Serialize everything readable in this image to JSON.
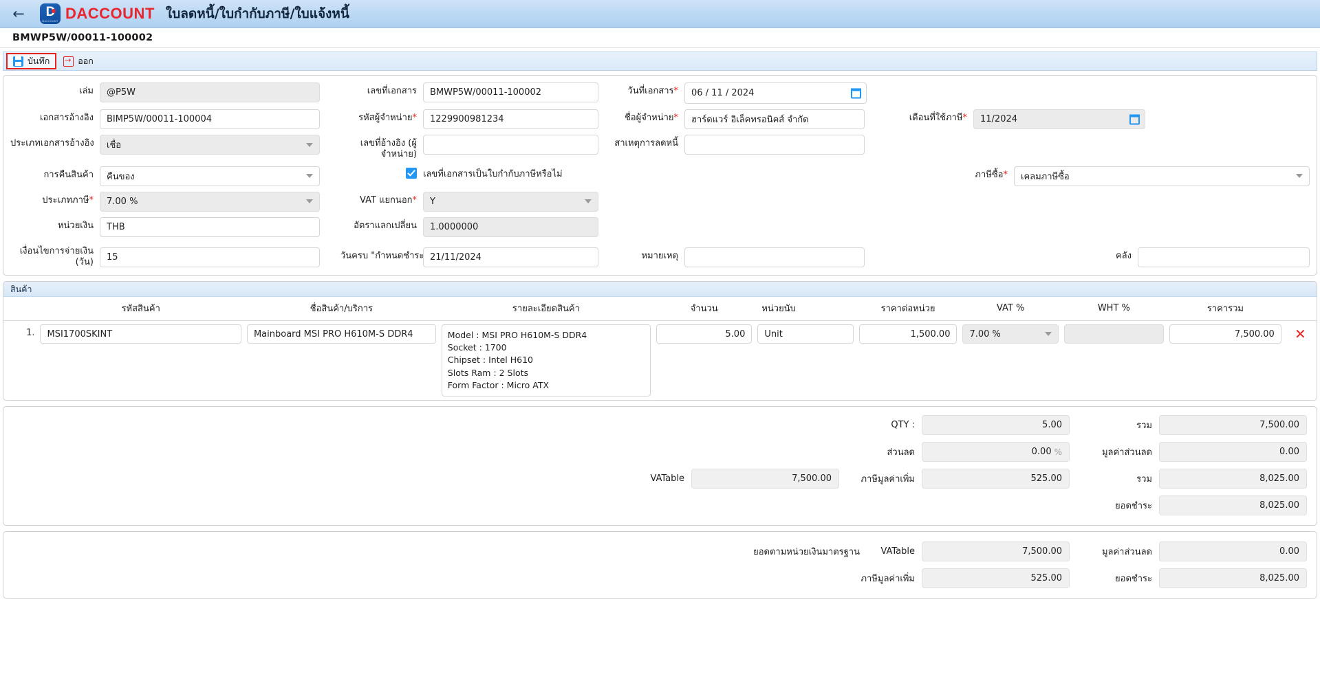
{
  "header": {
    "back_icon": "back-arrow-icon",
    "brand": "DACCOUNT",
    "brand_letter": "D",
    "logo_subtext": "DACCOUNT",
    "page_title": "ใบลดหนี้/ใบกำกับภาษี/ใบแจ้งหนี้",
    "document_number": "BMWP5W/00011-100002"
  },
  "toolbar": {
    "save_label": "บันทึก",
    "exit_label": "ออก",
    "save_icon": "save-disk-icon",
    "exit_icon": "exit-arrow-icon"
  },
  "form": {
    "book": {
      "label": "เล่ม",
      "value": "@P5W"
    },
    "doc_no": {
      "label": "เลขที่เอกสาร",
      "value": "BMWP5W/00011-100002"
    },
    "doc_date": {
      "label": "วันที่เอกสาร",
      "required": "*",
      "value": "06 / 11 / 2024"
    },
    "ref_doc": {
      "label": "เอกสารอ้างอิง",
      "value": "BIMP5W/00011-100004"
    },
    "vendor_code": {
      "label": "รหัสผู้จำหน่าย",
      "required": "*",
      "value": "1229900981234"
    },
    "vendor_name": {
      "label": "ชื่อผู้จำหน่าย",
      "required": "*",
      "value": "ฮาร์ดแวร์ อิเล็คทรอนิคส์ จำกัด"
    },
    "tax_month": {
      "label": "เดือนที่ใช้ภาษี",
      "required": "*",
      "value": "11/2024"
    },
    "ref_doc_type": {
      "label": "ประเภทเอกสารอ้างอิง",
      "value": "เชื่อ"
    },
    "vendor_ref_no": {
      "label": "เลขที่อ้างอิง (ผู้จำหน่าย)",
      "value": ""
    },
    "credit_reason": {
      "label": "สาเหตุการลดหนี้",
      "value": ""
    },
    "return_goods": {
      "label": "การคืนสินค้า",
      "value": "คืนของ"
    },
    "is_tax_invoice": {
      "label": "เลขที่เอกสารเป็นใบกำกับภาษีหรือไม่",
      "checked": true
    },
    "purchase_tax": {
      "label": "ภาษีซื้อ",
      "required": "*",
      "value": "เคลมภาษีซื้อ"
    },
    "tax_type": {
      "label": "ประเภทภาษี",
      "required": "*",
      "value": "7.00 %"
    },
    "vat_excluded": {
      "label": "VAT แยกนอก",
      "required": "*",
      "value": "Y"
    },
    "currency": {
      "label": "หน่วยเงิน",
      "value": "THB"
    },
    "exchange_rate": {
      "label": "อัตราแลกเปลี่ยน",
      "value": "1.0000000"
    },
    "payment_terms": {
      "label": "เงื่อนไขการจ่ายเงิน (วัน)",
      "value": "15"
    },
    "due_date": {
      "label": "วันครบ \"กำหนดชำระ\"",
      "value": "21/11/2024"
    },
    "remark": {
      "label": "หมายเหตุ",
      "value": ""
    },
    "warehouse": {
      "label": "คลัง",
      "value": ""
    }
  },
  "items_panel": {
    "title": "สินค้า",
    "columns": [
      "รหัสสินค้า",
      "ชื่อสินค้า/บริการ",
      "รายละเอียดสินค้า",
      "จำนวน",
      "หน่วยนับ",
      "ราคาต่อหน่วย",
      "VAT %",
      "WHT %",
      "ราคารวม"
    ],
    "rows": [
      {
        "index": "1.",
        "code": "MSI1700SKINT",
        "name": "Mainboard MSI PRO H610M-S DDR4",
        "description": "Model : MSI PRO H610M-S DDR4\nSocket : 1700\nChipset : Intel H610\nSlots Ram : 2 Slots\nForm Factor : Micro ATX",
        "qty": "5.00",
        "unit": "Unit",
        "unit_price": "1,500.00",
        "vat_pct": "7.00 %",
        "wht_pct": "",
        "total": "7,500.00",
        "delete_icon": "delete-row-icon"
      }
    ]
  },
  "summary": {
    "qty_label": "QTY :",
    "qty_value": "5.00",
    "total_label": "รวม",
    "total_value": "7,500.00",
    "discount_label": "ส่วนลด",
    "discount_value": "0.00",
    "discount_pct_suffix": "%",
    "discount_amount_label": "มูลค่าส่วนลด",
    "discount_amount_value": "0.00",
    "vatable_label": "VATable",
    "vatable_value": "7,500.00",
    "vat_label": "ภาษีมูลค่าเพิ่ม",
    "vat_value": "525.00",
    "grand_total_label": "รวม",
    "grand_total_value": "8,025.00",
    "net_label": "ยอดชำระ",
    "net_value": "8,025.00"
  },
  "base_currency": {
    "section_label": "ยอดตามหน่วยเงินมาตรฐาน",
    "vatable_label": "VATable",
    "vatable_value": "7,500.00",
    "discount_amount_label": "มูลค่าส่วนลด",
    "discount_amount_value": "0.00",
    "vat_label": "ภาษีมูลค่าเพิ่ม",
    "vat_value": "525.00",
    "net_label": "ยอดชำระ",
    "net_value": "8,025.00"
  },
  "colors": {
    "header_blue": "#bcd9f4",
    "brand_red": "#e8262d",
    "accent_blue": "#2196f3",
    "danger_red": "#e8221f"
  }
}
